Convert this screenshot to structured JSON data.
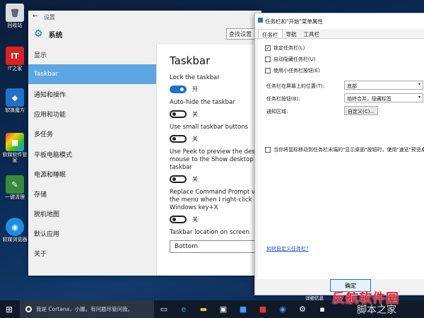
{
  "desktop": {
    "icons": [
      {
        "label": "回收站",
        "icon": "recycle-bin-icon"
      },
      {
        "label": "IT之家",
        "icon": "ithome-icon"
      },
      {
        "label": "软媒魔方",
        "icon": "cube-icon"
      },
      {
        "label": "软媒软件管家",
        "icon": "software-manager-icon"
      },
      {
        "label": "一键清理",
        "icon": "cleanup-icon"
      },
      {
        "label": "软媒浏览器",
        "icon": "browser-icon"
      }
    ]
  },
  "settings": {
    "window_title": "设置",
    "header": "系统",
    "search_placeholder": "查找设置",
    "nav": [
      "显示",
      "Taskbar",
      "通知和操作",
      "应用和功能",
      "多任务",
      "平板电脑模式",
      "电源和睡眠",
      "存储",
      "脱机地图",
      "默认应用",
      "关于"
    ],
    "active_index": 1,
    "content": {
      "title": "Taskbar",
      "options": [
        {
          "label": "Lock the taskbar",
          "state": "开",
          "on": true
        },
        {
          "label": "Auto-hide the taskbar",
          "state": "关",
          "on": false
        },
        {
          "label": "Use small taskbar buttons",
          "state": "关",
          "on": false
        },
        {
          "label": "Use Peek to preview the des",
          "label2": "mouse to the Show desktop",
          "label3": "taskbar",
          "state": "关",
          "on": false
        },
        {
          "label": "Replace Command Prompt v",
          "label2": "the menu when I right-click",
          "label3": "Windows key+X",
          "state": "关",
          "on": false
        }
      ],
      "location_label": "Taskbar location on screen",
      "location_value": "Bottom"
    }
  },
  "dialog": {
    "title": "任务栏和\"开始\"菜单属性",
    "tabs": [
      "任务栏",
      "导航",
      "工具栏"
    ],
    "active_tab": 0,
    "checks": [
      {
        "label": "锁定任务栏(L)",
        "checked": true
      },
      {
        "label": "自动隐藏任务栏(U)",
        "checked": false
      },
      {
        "label": "使用小任务栏按钮(E)",
        "checked": false
      }
    ],
    "position_label": "任务栏在屏幕上的位置(T):",
    "position_value": "底部",
    "buttons_label": "任务栏按钮(B):",
    "buttons_value": "始终合并，隐藏标签",
    "notify_label": "通知区域:",
    "customize_button": "自定义(C)...",
    "peek_label": "当你将鼠标移动到任务栏末端的\"显示桌面\"按钮时，使用\"速览\"预览桌",
    "help_link": "如何自定义任务栏?",
    "ok_button": "确定",
    "apply_hint": "详细信息"
  },
  "taskbar": {
    "cortana_text": "我是 Cortana，小娜。有问题尽管问我。",
    "watermark": "反航软件园",
    "watermark_sub": "脚本之家"
  }
}
